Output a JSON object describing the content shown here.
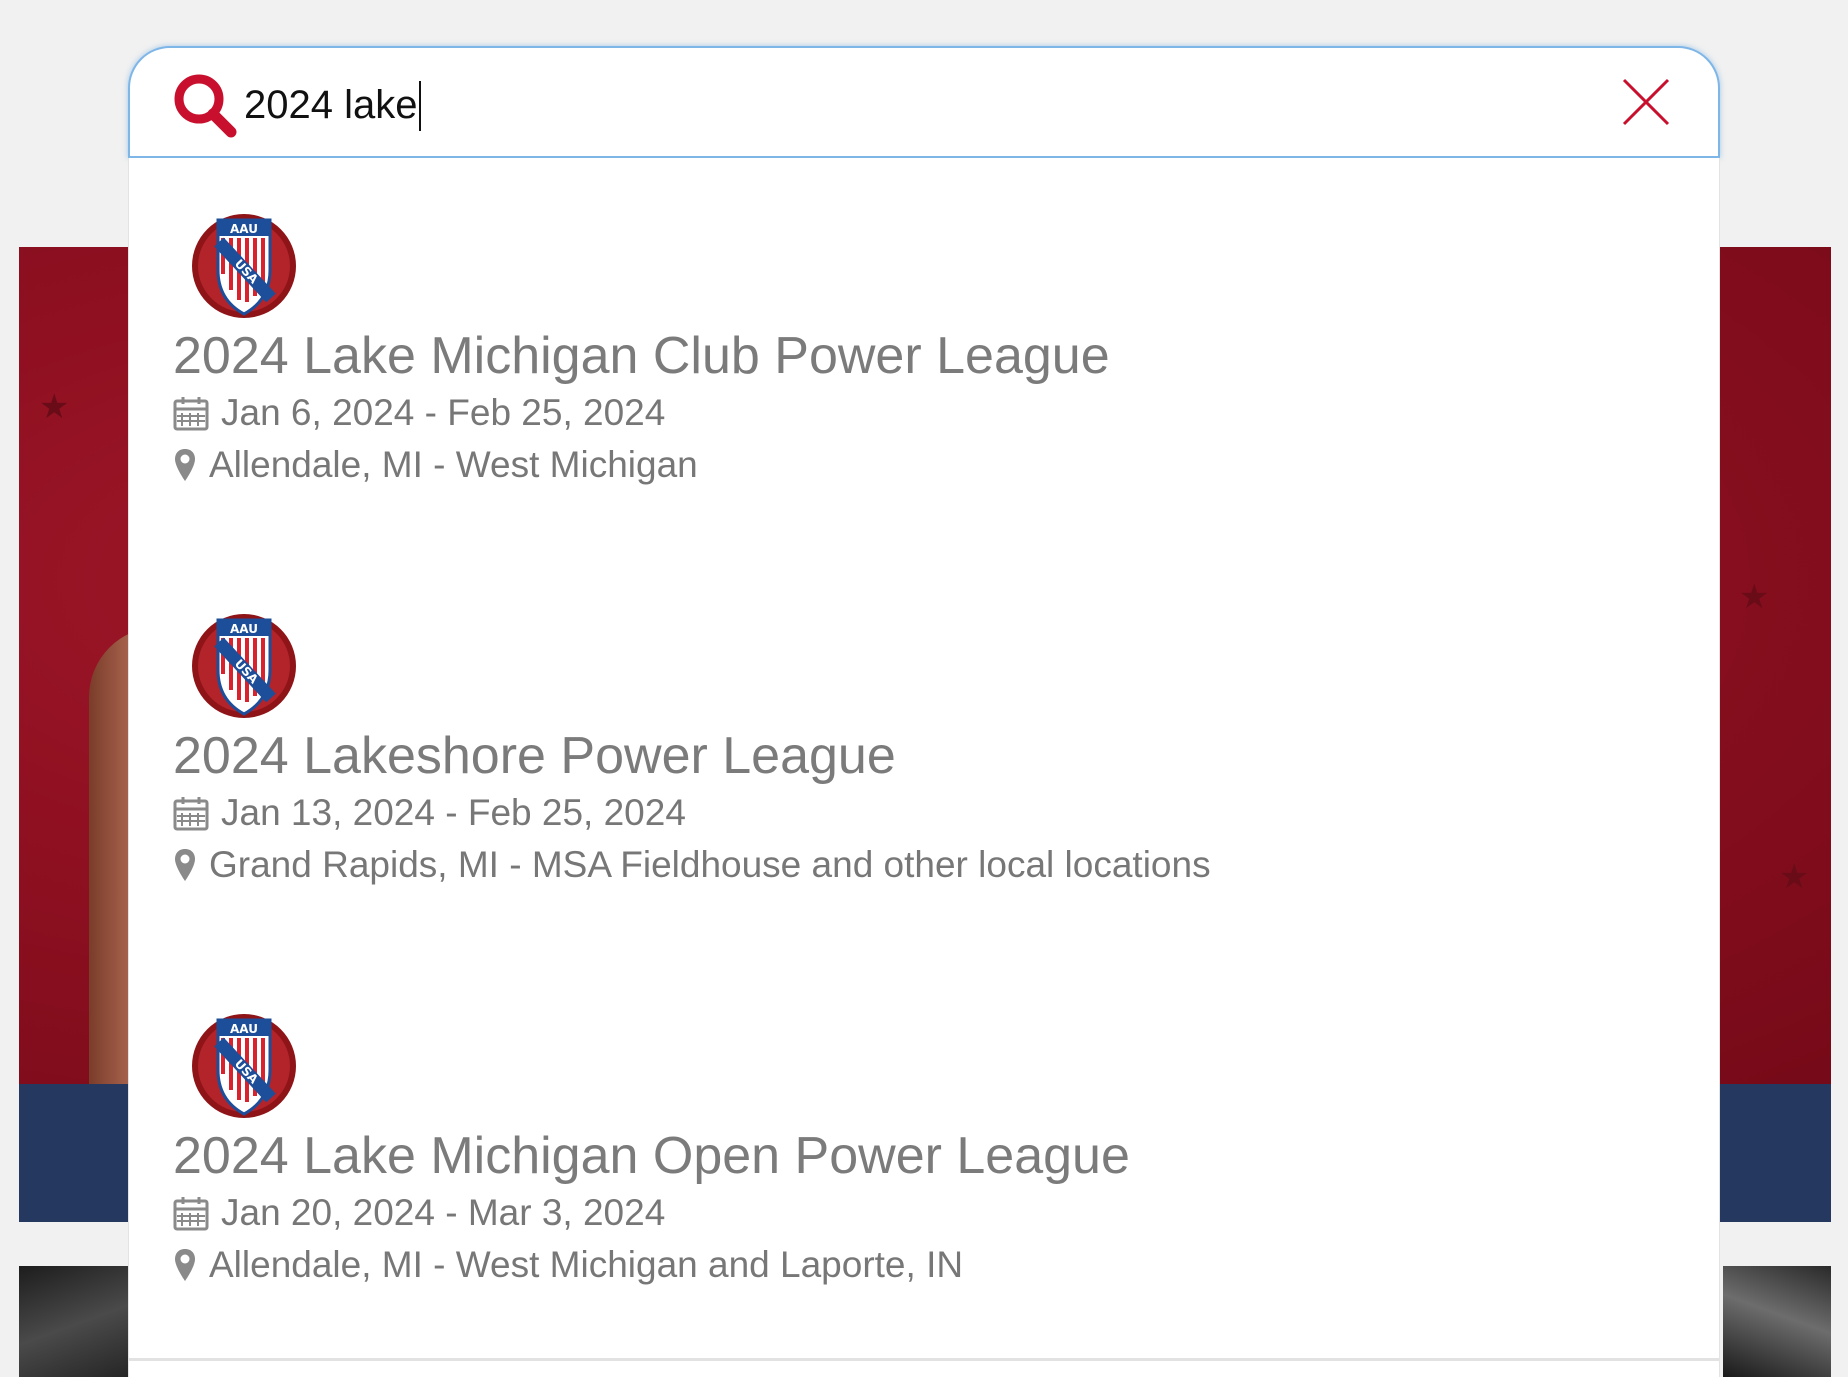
{
  "search": {
    "value": "2024 lake",
    "placeholder": ""
  },
  "results": [
    {
      "title": "2024 Lake Michigan Club Power League",
      "dates": "Jan 6, 2024 - Feb 25, 2024",
      "location": "Allendale, MI - West Michigan",
      "logo_text_top": "AAU",
      "logo_text_bottom": "USA"
    },
    {
      "title": "2024 Lakeshore Power League",
      "dates": "Jan 13, 2024 - Feb 25, 2024",
      "location": "Grand Rapids, MI - MSA Fieldhouse and other local locations",
      "logo_text_top": "AAU",
      "logo_text_bottom": "USA"
    },
    {
      "title": "2024 Lake Michigan Open Power League",
      "dates": "Jan 20, 2024 - Mar 3, 2024",
      "location": "Allendale, MI - West Michigan and Laporte, IN",
      "logo_text_top": "AAU",
      "logo_text_bottom": "USA"
    }
  ],
  "colors": {
    "accent_red": "#c8102e",
    "input_border": "#7fb6e8",
    "hero_bg": "#8f1021",
    "band_bg": "#25385f",
    "result_text": "#7b7b7b"
  },
  "icons": {
    "search": "search-icon",
    "close": "close-icon",
    "calendar": "calendar-icon",
    "location": "map-pin-icon",
    "logo": "aau-usa-shield-logo"
  }
}
